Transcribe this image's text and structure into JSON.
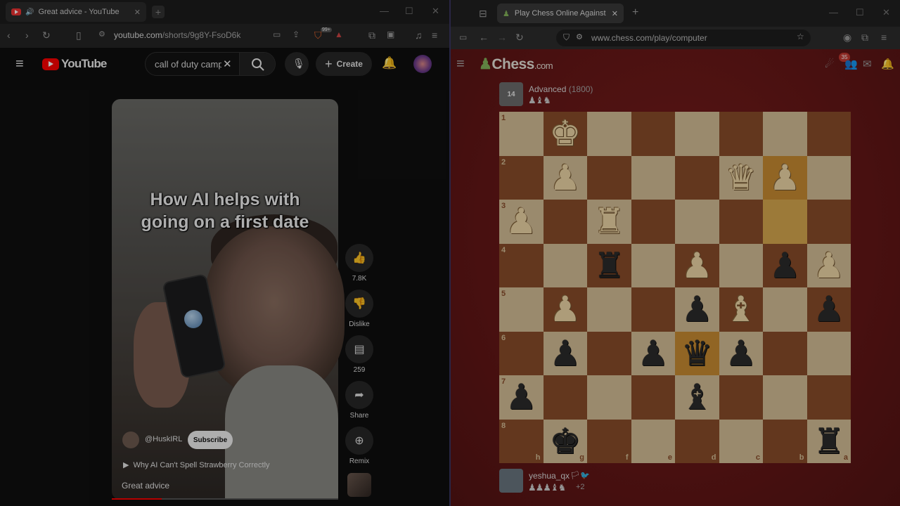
{
  "left_browser": {
    "tab_title": "Great advice - YouTube",
    "url_host": "youtube.com",
    "url_path": "/shorts/9g8Y-FsoD6k",
    "notif_badge": "99+"
  },
  "youtube": {
    "logo": "YouTube",
    "search_value": "call of duty camp",
    "create_label": "Create",
    "video_caption": "How AI helps with going on a first date",
    "likes": "7.8K",
    "dislike_label": "Dislike",
    "comments": "259",
    "share_label": "Share",
    "remix_label": "Remix",
    "channel": "@HuskIRL",
    "subscribe_label": "Subscribe",
    "related": "Why AI Can't Spell Strawberry Correctly",
    "title": "Great advice",
    "progress": 0.22,
    "icons": [
      "menu-icon",
      "search-icon",
      "mic-icon",
      "bell-icon",
      "like-icon",
      "dislike-icon",
      "comment-icon",
      "share-icon",
      "remix-icon"
    ]
  },
  "right_browser": {
    "tab_title": "Play Chess Online Against the C",
    "url": "www.chess.com/play/computer"
  },
  "chess": {
    "logo_main": "Chess",
    "logo_suffix": ".com",
    "notif_count": "35",
    "opponent_level": "14",
    "opponent_name": "Advanced",
    "opponent_rating": "(1800)",
    "opponent_captured": "♟♝♞",
    "player_name": "yeshua_qx",
    "player_captured": "♟♟♟♝♞",
    "player_advantage": "+2",
    "files": [
      "h",
      "g",
      "f",
      "e",
      "d",
      "c",
      "b",
      "a"
    ],
    "ranks": [
      "1",
      "2",
      "3",
      "4",
      "5",
      "6",
      "7",
      "8"
    ],
    "highlight": [
      "b2",
      "b3",
      "d6"
    ],
    "board": [
      [
        "",
        "K",
        "",
        "",
        "",
        "",
        "",
        ""
      ],
      [
        "",
        "P",
        "",
        "",
        "",
        "Q",
        "P",
        ""
      ],
      [
        "P",
        "",
        "R",
        "",
        "",
        "",
        "",
        ""
      ],
      [
        "",
        "",
        "r",
        "",
        "P",
        "",
        "p",
        "P"
      ],
      [
        "",
        "P",
        "",
        "",
        "p",
        "B",
        "",
        "p"
      ],
      [
        "",
        "p",
        "",
        "p",
        "q",
        "p",
        "",
        ""
      ],
      [
        "p",
        "",
        "",
        "",
        "b",
        "",
        "",
        ""
      ],
      [
        "",
        "k",
        "",
        "",
        "",
        "",
        "",
        "r"
      ]
    ]
  }
}
